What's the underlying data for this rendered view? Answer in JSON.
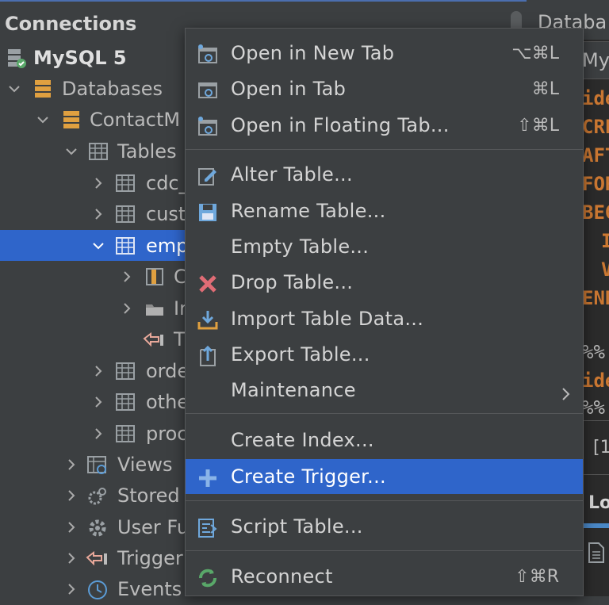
{
  "connections": {
    "title": "Connections",
    "tree": [
      {
        "label": "MySQL 5",
        "icon": "server-icon",
        "bold": true
      },
      {
        "label": "Databases",
        "icon": "database-icon"
      },
      {
        "label": "ContactM",
        "icon": "database-icon"
      },
      {
        "label": "Tables",
        "icon": "tables-icon"
      },
      {
        "label": "cdc_",
        "icon": "table-icon"
      },
      {
        "label": "cust",
        "icon": "table-icon"
      },
      {
        "label": "emp",
        "icon": "table-icon",
        "selected": true
      },
      {
        "label": "C",
        "icon": "columns-icon"
      },
      {
        "label": "Ir",
        "icon": "indexes-icon"
      },
      {
        "label": "T",
        "icon": "trigger-icon"
      },
      {
        "label": "orde",
        "icon": "table-icon"
      },
      {
        "label": "othe",
        "icon": "table-icon"
      },
      {
        "label": "proc",
        "icon": "table-icon"
      },
      {
        "label": "Views",
        "icon": "views-icon"
      },
      {
        "label": "Stored",
        "icon": "stored-proc-icon"
      },
      {
        "label": "User Fu",
        "icon": "function-gear-icon"
      },
      {
        "label": "Trigger",
        "icon": "trigger-icon"
      },
      {
        "label": "Events",
        "icon": "clock-icon"
      }
    ]
  },
  "right_panel": {
    "tab_label": "Databa",
    "subtab_label": "My",
    "code_lines": [
      "ide",
      "CRE",
      "AFT",
      "FOR",
      "BEG",
      "I",
      "V",
      "END",
      "",
      "%%",
      "ide",
      "%%"
    ],
    "status_fragment": "[1",
    "bottom_tab": "Lo"
  },
  "context_menu": {
    "items": [
      {
        "label": "Open in New Tab",
        "shortcut": "⌥⌘L",
        "icon": "new-tab-icon"
      },
      {
        "label": "Open in Tab",
        "shortcut": "⌘L",
        "icon": "tab-icon"
      },
      {
        "label": "Open in Floating Tab...",
        "shortcut": "⇧⌘L",
        "icon": "floating-tab-icon"
      },
      {
        "label": "Alter Table...",
        "shortcut": "",
        "icon": "edit-pencil-icon"
      },
      {
        "label": "Rename Table...",
        "shortcut": "",
        "icon": "save-disk-icon"
      },
      {
        "label": "Empty Table...",
        "shortcut": "",
        "icon": ""
      },
      {
        "label": "Drop Table...",
        "shortcut": "",
        "icon": "red-x-icon"
      },
      {
        "label": "Import Table Data...",
        "shortcut": "",
        "icon": "import-icon"
      },
      {
        "label": "Export Table...",
        "shortcut": "",
        "icon": "export-icon"
      },
      {
        "label": "Maintenance",
        "shortcut": "",
        "icon": "",
        "submenu": true
      },
      {
        "label": "Create Index...",
        "shortcut": "",
        "icon": ""
      },
      {
        "label": "Create Trigger...",
        "shortcut": "",
        "icon": "plus-icon",
        "highlighted": true
      },
      {
        "label": "Script Table...",
        "shortcut": "",
        "icon": "script-icon"
      },
      {
        "label": "Reconnect",
        "shortcut": "⇧⌘R",
        "icon": "reconnect-icon"
      }
    ]
  },
  "colors": {
    "selection": "#2f65ca",
    "panel_bg": "#3c3f41",
    "editor_bg": "#2b2b2b",
    "keyword": "#cc7832"
  }
}
